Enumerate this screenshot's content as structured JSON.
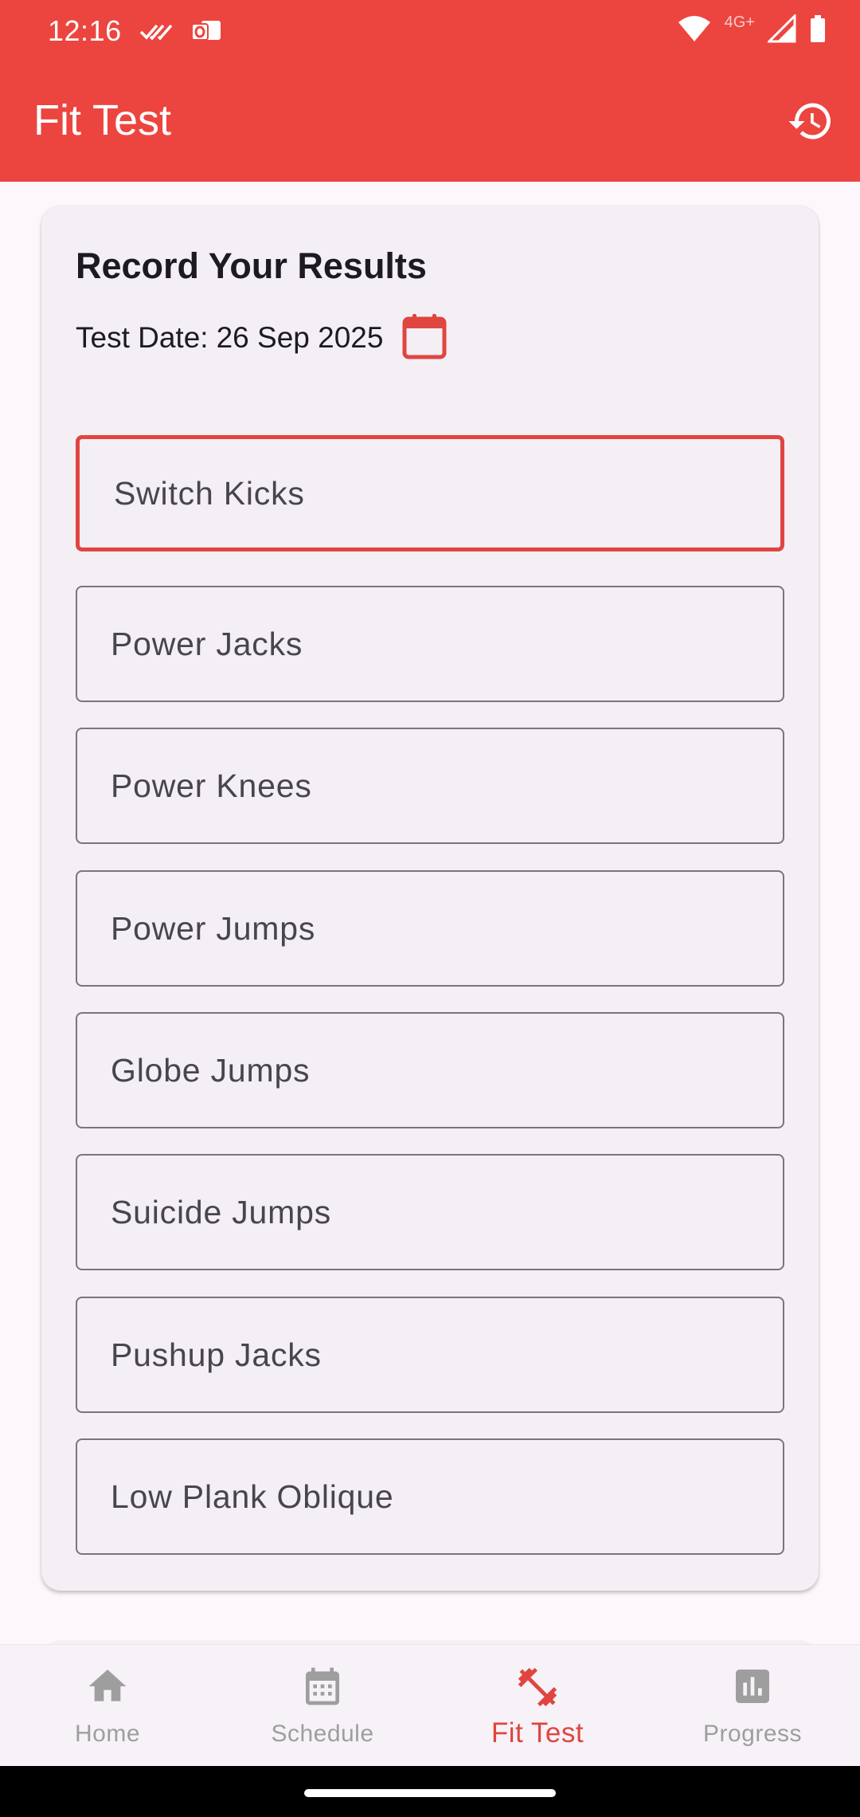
{
  "status_bar": {
    "time": "12:16",
    "network_label": "4G+"
  },
  "app_bar": {
    "title": "Fit Test",
    "history_icon": "history-icon"
  },
  "card": {
    "title": "Record Your Results",
    "date_label": "Test Date:",
    "date_value": "26 Sep 2025",
    "fields": [
      {
        "label": "Switch Kicks",
        "focused": true
      },
      {
        "label": "Power Jacks"
      },
      {
        "label": "Power Knees"
      },
      {
        "label": "Power Jumps"
      },
      {
        "label": "Globe Jumps"
      },
      {
        "label": "Suicide Jumps"
      },
      {
        "label": "Pushup Jacks"
      },
      {
        "label": "Low Plank Oblique"
      }
    ]
  },
  "bottom_nav": {
    "items": [
      {
        "label": "Home",
        "icon": "home-icon"
      },
      {
        "label": "Schedule",
        "icon": "calendar-icon"
      },
      {
        "label": "Fit Test",
        "icon": "dumbbell-icon",
        "active": true
      },
      {
        "label": "Progress",
        "icon": "chart-icon"
      }
    ]
  },
  "colors": {
    "accent": "#ec4540",
    "active_text": "#e04540",
    "inactive_text": "#9e9e9e"
  }
}
